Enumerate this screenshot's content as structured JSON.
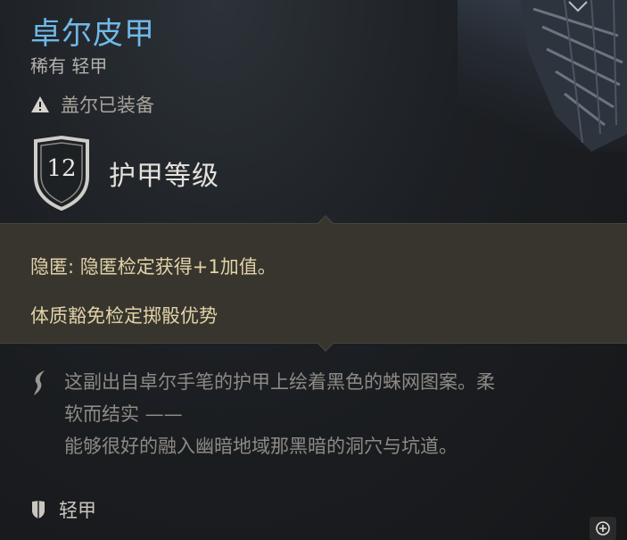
{
  "item": {
    "name": "卓尔皮甲",
    "rarity_type": "稀有 轻甲",
    "equipped_text": "盖尔已装备",
    "armor_class_value": "12",
    "armor_class_label": "护甲等级"
  },
  "effects": [
    "隐匿: 隐匿检定获得+1加值。",
    "体质豁免检定掷骰优势"
  ],
  "description": {
    "line1": "这副出自卓尔手笔的护甲上绘着黑色的蛛网图案。柔",
    "line2": "软而结实 ——",
    "line3": "能够很好的融入幽暗地域那黑暗的洞穴与坑道。"
  },
  "footer": {
    "armor_type": "轻甲"
  },
  "icons": {
    "warning": "warning-triangle-icon",
    "shield": "shield-icon",
    "quill": "quill-icon",
    "small_shield": "light-armor-shield-icon",
    "zoom": "zoom-in-icon"
  },
  "colors": {
    "name": "#6fb9e8",
    "effects_text": "#e1d3a8",
    "effects_bg": "#38352e",
    "description_text": "#8d8a85"
  }
}
